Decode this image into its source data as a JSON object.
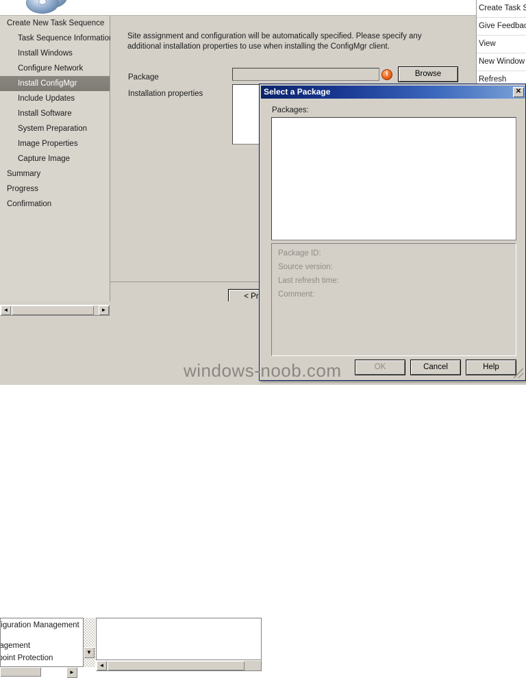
{
  "wizard": {
    "banner_icon": "cd-disc-icon",
    "nav_items": [
      {
        "label": "Create New Task Sequence",
        "level": 1,
        "selected": false
      },
      {
        "label": "Task Sequence Information",
        "level": 2,
        "selected": false
      },
      {
        "label": "Install Windows",
        "level": 2,
        "selected": false
      },
      {
        "label": "Configure Network",
        "level": 2,
        "selected": false
      },
      {
        "label": "Install ConfigMgr",
        "level": 2,
        "selected": true
      },
      {
        "label": "Include Updates",
        "level": 2,
        "selected": false
      },
      {
        "label": "Install Software",
        "level": 2,
        "selected": false
      },
      {
        "label": "System Preparation",
        "level": 2,
        "selected": false
      },
      {
        "label": "Image Properties",
        "level": 2,
        "selected": false
      },
      {
        "label": "Capture Image",
        "level": 2,
        "selected": false
      },
      {
        "label": "Summary",
        "level": 1,
        "selected": false
      },
      {
        "label": "Progress",
        "level": 1,
        "selected": false
      },
      {
        "label": "Confirmation",
        "level": 1,
        "selected": false
      }
    ],
    "description": "Site assignment and configuration will be automatically specified. Please specify any additional installation properties to use when installing the ConfigMgr client.",
    "package_label": "Package",
    "package_value": "",
    "error_icon": "error-exclamation-icon",
    "browse_label": "Browse",
    "install_props_label": "Installation properties",
    "install_props_value": "",
    "prev_label": "< Prev"
  },
  "action_menu": {
    "items": [
      {
        "label": "Create Task S"
      },
      {
        "label": "Give Feedbac"
      },
      {
        "label": "View"
      },
      {
        "label": "New Window"
      },
      {
        "label": "Refresh"
      }
    ]
  },
  "console": {
    "tree_items": [
      {
        "label": "Configuration Management"
      },
      {
        "label": "Management"
      },
      {
        "label": "Endpoint Protection"
      }
    ],
    "scroll_left_glyph": "◄",
    "scroll_right_glyph": "►",
    "scroll_down_glyph": "▼"
  },
  "dialog": {
    "title": "Select a Package",
    "close_label": "✕",
    "packages_label": "Packages:",
    "package_rows": [],
    "details": [
      {
        "label": "Package ID:"
      },
      {
        "label": "Source version:"
      },
      {
        "label": "Last refresh time:"
      },
      {
        "label": "Comment:"
      }
    ],
    "buttons": {
      "ok": "OK",
      "cancel": "Cancel",
      "help": "Help"
    },
    "resize_grip": "resize-grip-icon"
  },
  "watermark": {
    "text": "windows-noob.com"
  },
  "colors": {
    "dialog_title_start": "#0a246a",
    "dialog_title_end": "#7ba3d8",
    "window_face": "#d4d0c8",
    "nav_selected": "#84807a",
    "error_icon": "#f2712b",
    "disabled_text": "#8f8b85"
  }
}
